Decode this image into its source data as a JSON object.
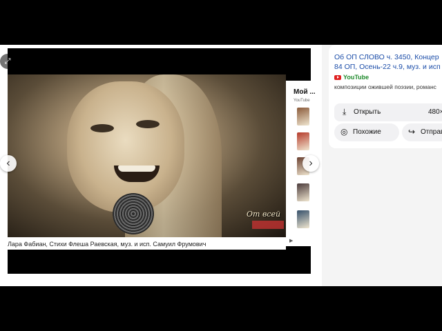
{
  "viewer": {
    "caption": "Лара Фабиан, Стихи Флеша Раевская, муз. и исп. Самуил Фрумович",
    "watermark": "От всей",
    "side_title": "Мой ...",
    "side_source": "YouTube",
    "expand_icon": "expand-icon",
    "prev_icon": "chevron-left-icon",
    "next_icon": "chevron-right-icon",
    "thumbnails": [
      "#8a5a3a",
      "#b53a2a",
      "#6a4030",
      "#4a3a3a",
      "#35506a"
    ]
  },
  "details": {
    "title_line1": "Об ОП СЛОВО ч. 3450, Концер",
    "title_line2": "84 ОП, Осень-22 ч.9, муз. и исп",
    "source": "YouTube",
    "description": "композиции ожившей поэзии, романс",
    "open_label": "Открыть",
    "open_resolution": "480×",
    "similar_label": "Похожие",
    "share_label": "Отправ",
    "colors": {
      "link": "#1a4ca8",
      "source": "#1f8a2c",
      "youtube_red": "#e02020"
    }
  }
}
